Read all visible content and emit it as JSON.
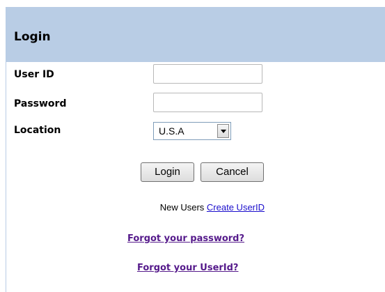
{
  "header": {
    "title": "Login"
  },
  "form": {
    "user_id_label": "User ID",
    "user_id_value": "",
    "password_label": "Password",
    "password_value": "",
    "location_label": "Location",
    "location_selected": "U.S.A"
  },
  "buttons": {
    "login": "Login",
    "cancel": "Cancel"
  },
  "links": {
    "new_users_text": "New Users",
    "create_userid": "Create UserID",
    "forgot_password": "Forgot your password?",
    "forgot_userid": "Forgot your UserId?"
  }
}
